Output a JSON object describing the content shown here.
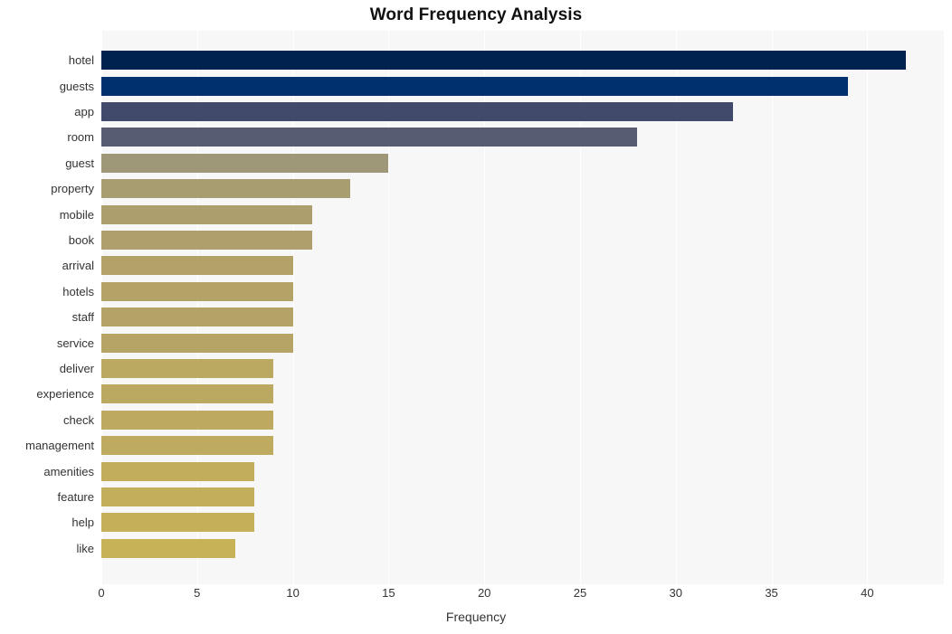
{
  "chart_data": {
    "type": "bar",
    "orientation": "horizontal",
    "title": "Word Frequency Analysis",
    "xlabel": "Frequency",
    "ylabel": "",
    "xlim": [
      0,
      44
    ],
    "ylim": null,
    "grid": true,
    "legend": null,
    "xticks": [
      0,
      5,
      10,
      15,
      20,
      25,
      30,
      35,
      40
    ],
    "xtick_labels": [
      "0",
      "5",
      "10",
      "15",
      "20",
      "25",
      "30",
      "35",
      "40"
    ],
    "categories": [
      "hotel",
      "guests",
      "app",
      "room",
      "guest",
      "property",
      "mobile",
      "book",
      "arrival",
      "hotels",
      "staff",
      "service",
      "deliver",
      "experience",
      "check",
      "management",
      "amenities",
      "feature",
      "help",
      "like"
    ],
    "values": [
      42,
      39,
      33,
      28,
      15,
      13,
      11,
      11,
      10,
      10,
      10,
      10,
      9,
      9,
      9,
      9,
      8,
      8,
      8,
      7
    ],
    "bar_colors": [
      "#00224e",
      "#00306e",
      "#414a6b",
      "#575c72",
      "#9e9878",
      "#a79d70",
      "#ad9f6d",
      "#ae9f6d",
      "#b2a268",
      "#b3a367",
      "#b4a366",
      "#b5a465",
      "#bba962",
      "#bca961",
      "#bdaa60",
      "#bfab5f",
      "#c2ad5c",
      "#c3ae5b",
      "#c5af59",
      "#c8b257"
    ],
    "plot_background": "#f7f7f7",
    "gridline_color": "#ffffff",
    "text_color": "#333333",
    "title_color": "#111111"
  }
}
